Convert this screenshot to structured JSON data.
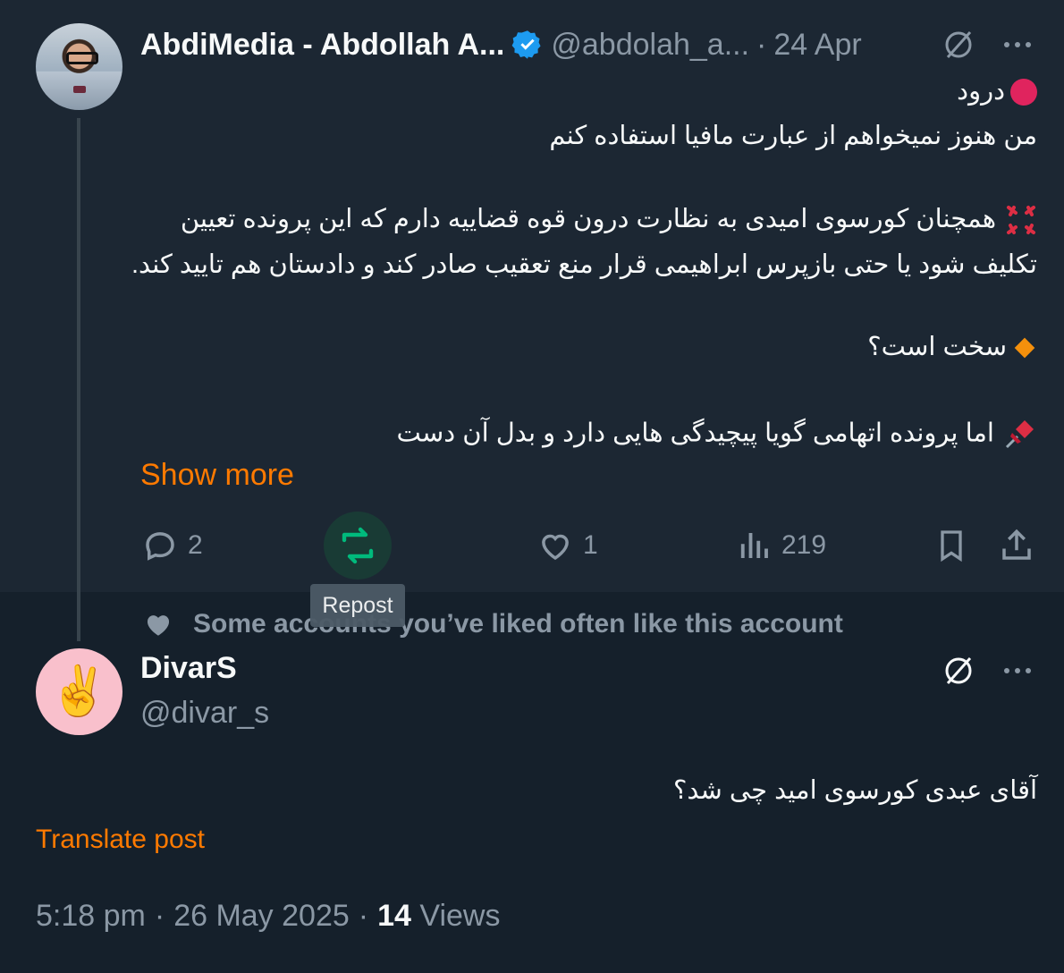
{
  "tweet1": {
    "author_name": "AbdiMedia - Abdollah A...",
    "handle": "@abdolah_a...",
    "separator": "·",
    "date": "24 Apr",
    "lines": [
      "درود",
      "من هنوز نمیخواهم از عبارت مافیا استفاده کنم",
      "همچنان کورسوی امیدی به نظارت درون قوه قضاییه دارم که این پرونده تعیین",
      "تکلیف شود یا حتی بازپرس ابراهیمی قرار منع تعقیب صادر کند و دادستان هم تایید کند.",
      "سخت است؟",
      "اما پرونده اتهامی گویا پیچیدگی هایی دارد و بدل آن دست"
    ],
    "show_more": "Show more",
    "actions": {
      "replies": "2",
      "likes": "1",
      "views": "219"
    },
    "tooltip": "Repost",
    "icons": [
      "verified-badge-icon",
      "grok-icon",
      "more-icon",
      "red-circle-icon",
      "anger-icon",
      "orange-diamond-icon",
      "pushpin-icon",
      "reply-icon",
      "repost-icon",
      "like-icon",
      "views-icon",
      "bookmark-icon",
      "share-icon"
    ]
  },
  "social_context": {
    "text": "Some accounts you’ve liked often like this account"
  },
  "tweet2": {
    "author_name": "DivarS",
    "handle": "@divar_s",
    "avatar_emoji": "✌️",
    "text": "آقای عبدی کورسوی امید چی شد؟",
    "translate": "Translate post",
    "time": "5:18 pm",
    "separator": "·",
    "date": "26 May 2025",
    "views_count": "14",
    "views_label": "Views"
  },
  "colors": {
    "background": "#15202b",
    "highlight": "#1c2733",
    "accent_link": "#ff7a00",
    "muted": "#8b98a5",
    "verified": "#1d9bf0",
    "repost_green": "#00ba7c"
  }
}
